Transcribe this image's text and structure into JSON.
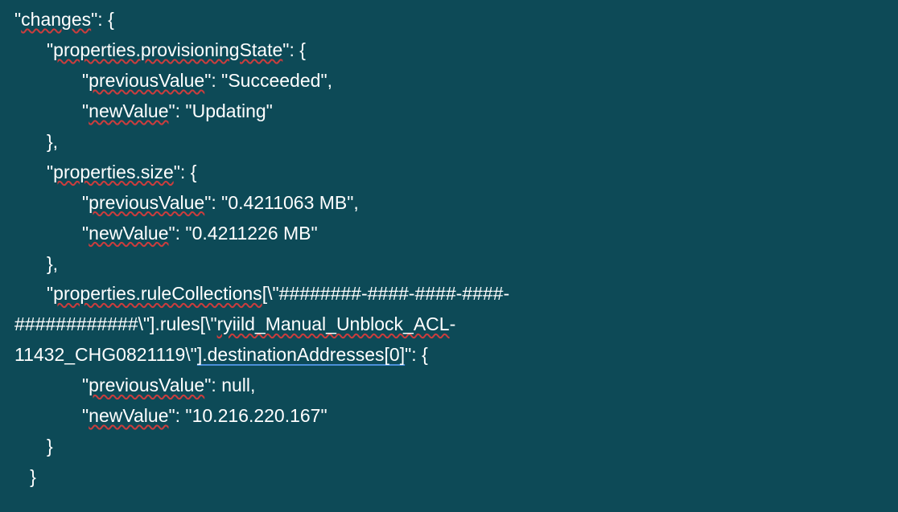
{
  "lines": {
    "l01_key": "changes",
    "l02_key": "properties.provisioningState",
    "l03_key": "previousValue",
    "l03_val": "Succeeded",
    "l04_key": "newValue",
    "l04_val": "Updating",
    "l06_key": "properties.size",
    "l07_key": "previousValue",
    "l07_val": "0.4211063 MB",
    "l08_key": "newValue",
    "l08_val": "0.4211226 MB",
    "l10_a": "properties.ruleCollections",
    "l10_b": "[\\\"########-####-####-####-",
    "l11": "############\\\"].rules[\\\"",
    "l11_b": "ryiild_Manual_Unblock_ACL",
    "l11_c": "-",
    "l12_a": "11432_CHG0821119\\\"",
    "l12_b": "].destinationAddresses[0]",
    "l13_key": "previousValue",
    "l13_val": "null",
    "l14_key": "newValue",
    "l14_val": "10.216.220.167"
  }
}
